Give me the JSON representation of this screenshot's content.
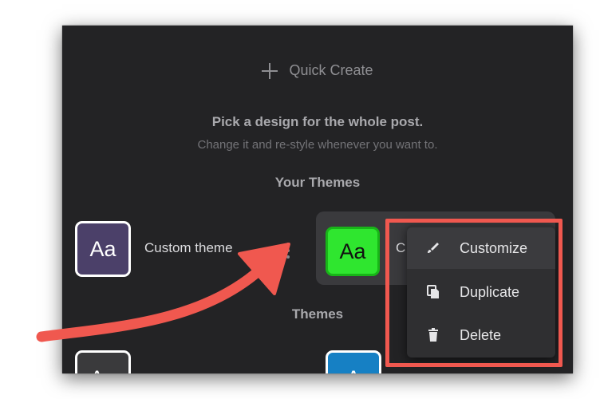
{
  "quick_create": {
    "label": "Quick Create",
    "icon": "plus-icon"
  },
  "intro": {
    "heading": "Pick a design for the whole post.",
    "subheading": "Change it and re-style whenever you want to."
  },
  "your_themes": {
    "title": "Your Themes",
    "items": [
      {
        "swatch_text": "Aa",
        "label": "Custom theme",
        "swatch_color": "#4b4069"
      },
      {
        "swatch_text": "Aa",
        "label": "C",
        "swatch_color": "#2fe62f"
      }
    ]
  },
  "themes": {
    "title": "Themes",
    "items": [
      {
        "swatch_text": "Aa",
        "swatch_color": "#3a3a3c"
      },
      {
        "swatch_text": "A",
        "swatch_color": "#1680c4"
      }
    ]
  },
  "context_menu": {
    "items": [
      {
        "label": "Customize",
        "icon": "brush-icon"
      },
      {
        "label": "Duplicate",
        "icon": "copy-icon"
      },
      {
        "label": "Delete",
        "icon": "trash-icon"
      }
    ]
  },
  "annotation": {
    "arrow_color": "#f0584f",
    "box_color": "#f0584f"
  }
}
